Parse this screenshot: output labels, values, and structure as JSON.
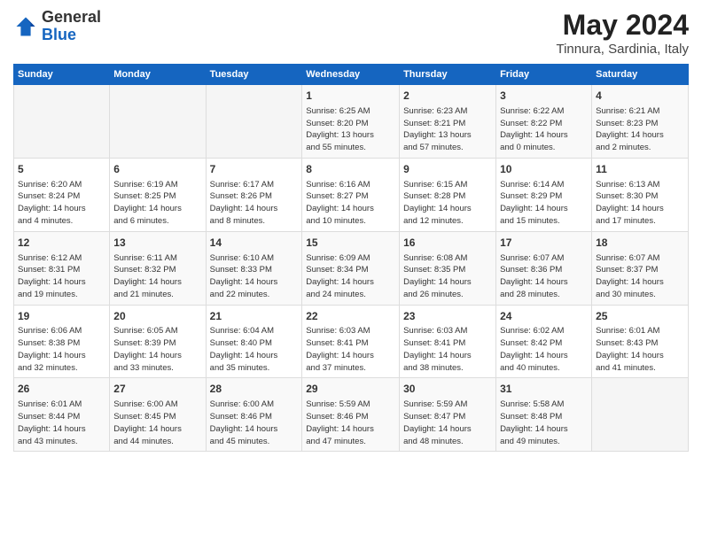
{
  "header": {
    "logo_general": "General",
    "logo_blue": "Blue",
    "title": "May 2024",
    "subtitle": "Tinnura, Sardinia, Italy"
  },
  "weekdays": [
    "Sunday",
    "Monday",
    "Tuesday",
    "Wednesday",
    "Thursday",
    "Friday",
    "Saturday"
  ],
  "weeks": [
    [
      {
        "day": "",
        "info": ""
      },
      {
        "day": "",
        "info": ""
      },
      {
        "day": "",
        "info": ""
      },
      {
        "day": "1",
        "info": "Sunrise: 6:25 AM\nSunset: 8:20 PM\nDaylight: 13 hours\nand 55 minutes."
      },
      {
        "day": "2",
        "info": "Sunrise: 6:23 AM\nSunset: 8:21 PM\nDaylight: 13 hours\nand 57 minutes."
      },
      {
        "day": "3",
        "info": "Sunrise: 6:22 AM\nSunset: 8:22 PM\nDaylight: 14 hours\nand 0 minutes."
      },
      {
        "day": "4",
        "info": "Sunrise: 6:21 AM\nSunset: 8:23 PM\nDaylight: 14 hours\nand 2 minutes."
      }
    ],
    [
      {
        "day": "5",
        "info": "Sunrise: 6:20 AM\nSunset: 8:24 PM\nDaylight: 14 hours\nand 4 minutes."
      },
      {
        "day": "6",
        "info": "Sunrise: 6:19 AM\nSunset: 8:25 PM\nDaylight: 14 hours\nand 6 minutes."
      },
      {
        "day": "7",
        "info": "Sunrise: 6:17 AM\nSunset: 8:26 PM\nDaylight: 14 hours\nand 8 minutes."
      },
      {
        "day": "8",
        "info": "Sunrise: 6:16 AM\nSunset: 8:27 PM\nDaylight: 14 hours\nand 10 minutes."
      },
      {
        "day": "9",
        "info": "Sunrise: 6:15 AM\nSunset: 8:28 PM\nDaylight: 14 hours\nand 12 minutes."
      },
      {
        "day": "10",
        "info": "Sunrise: 6:14 AM\nSunset: 8:29 PM\nDaylight: 14 hours\nand 15 minutes."
      },
      {
        "day": "11",
        "info": "Sunrise: 6:13 AM\nSunset: 8:30 PM\nDaylight: 14 hours\nand 17 minutes."
      }
    ],
    [
      {
        "day": "12",
        "info": "Sunrise: 6:12 AM\nSunset: 8:31 PM\nDaylight: 14 hours\nand 19 minutes."
      },
      {
        "day": "13",
        "info": "Sunrise: 6:11 AM\nSunset: 8:32 PM\nDaylight: 14 hours\nand 21 minutes."
      },
      {
        "day": "14",
        "info": "Sunrise: 6:10 AM\nSunset: 8:33 PM\nDaylight: 14 hours\nand 22 minutes."
      },
      {
        "day": "15",
        "info": "Sunrise: 6:09 AM\nSunset: 8:34 PM\nDaylight: 14 hours\nand 24 minutes."
      },
      {
        "day": "16",
        "info": "Sunrise: 6:08 AM\nSunset: 8:35 PM\nDaylight: 14 hours\nand 26 minutes."
      },
      {
        "day": "17",
        "info": "Sunrise: 6:07 AM\nSunset: 8:36 PM\nDaylight: 14 hours\nand 28 minutes."
      },
      {
        "day": "18",
        "info": "Sunrise: 6:07 AM\nSunset: 8:37 PM\nDaylight: 14 hours\nand 30 minutes."
      }
    ],
    [
      {
        "day": "19",
        "info": "Sunrise: 6:06 AM\nSunset: 8:38 PM\nDaylight: 14 hours\nand 32 minutes."
      },
      {
        "day": "20",
        "info": "Sunrise: 6:05 AM\nSunset: 8:39 PM\nDaylight: 14 hours\nand 33 minutes."
      },
      {
        "day": "21",
        "info": "Sunrise: 6:04 AM\nSunset: 8:40 PM\nDaylight: 14 hours\nand 35 minutes."
      },
      {
        "day": "22",
        "info": "Sunrise: 6:03 AM\nSunset: 8:41 PM\nDaylight: 14 hours\nand 37 minutes."
      },
      {
        "day": "23",
        "info": "Sunrise: 6:03 AM\nSunset: 8:41 PM\nDaylight: 14 hours\nand 38 minutes."
      },
      {
        "day": "24",
        "info": "Sunrise: 6:02 AM\nSunset: 8:42 PM\nDaylight: 14 hours\nand 40 minutes."
      },
      {
        "day": "25",
        "info": "Sunrise: 6:01 AM\nSunset: 8:43 PM\nDaylight: 14 hours\nand 41 minutes."
      }
    ],
    [
      {
        "day": "26",
        "info": "Sunrise: 6:01 AM\nSunset: 8:44 PM\nDaylight: 14 hours\nand 43 minutes."
      },
      {
        "day": "27",
        "info": "Sunrise: 6:00 AM\nSunset: 8:45 PM\nDaylight: 14 hours\nand 44 minutes."
      },
      {
        "day": "28",
        "info": "Sunrise: 6:00 AM\nSunset: 8:46 PM\nDaylight: 14 hours\nand 45 minutes."
      },
      {
        "day": "29",
        "info": "Sunrise: 5:59 AM\nSunset: 8:46 PM\nDaylight: 14 hours\nand 47 minutes."
      },
      {
        "day": "30",
        "info": "Sunrise: 5:59 AM\nSunset: 8:47 PM\nDaylight: 14 hours\nand 48 minutes."
      },
      {
        "day": "31",
        "info": "Sunrise: 5:58 AM\nSunset: 8:48 PM\nDaylight: 14 hours\nand 49 minutes."
      },
      {
        "day": "",
        "info": ""
      }
    ]
  ]
}
